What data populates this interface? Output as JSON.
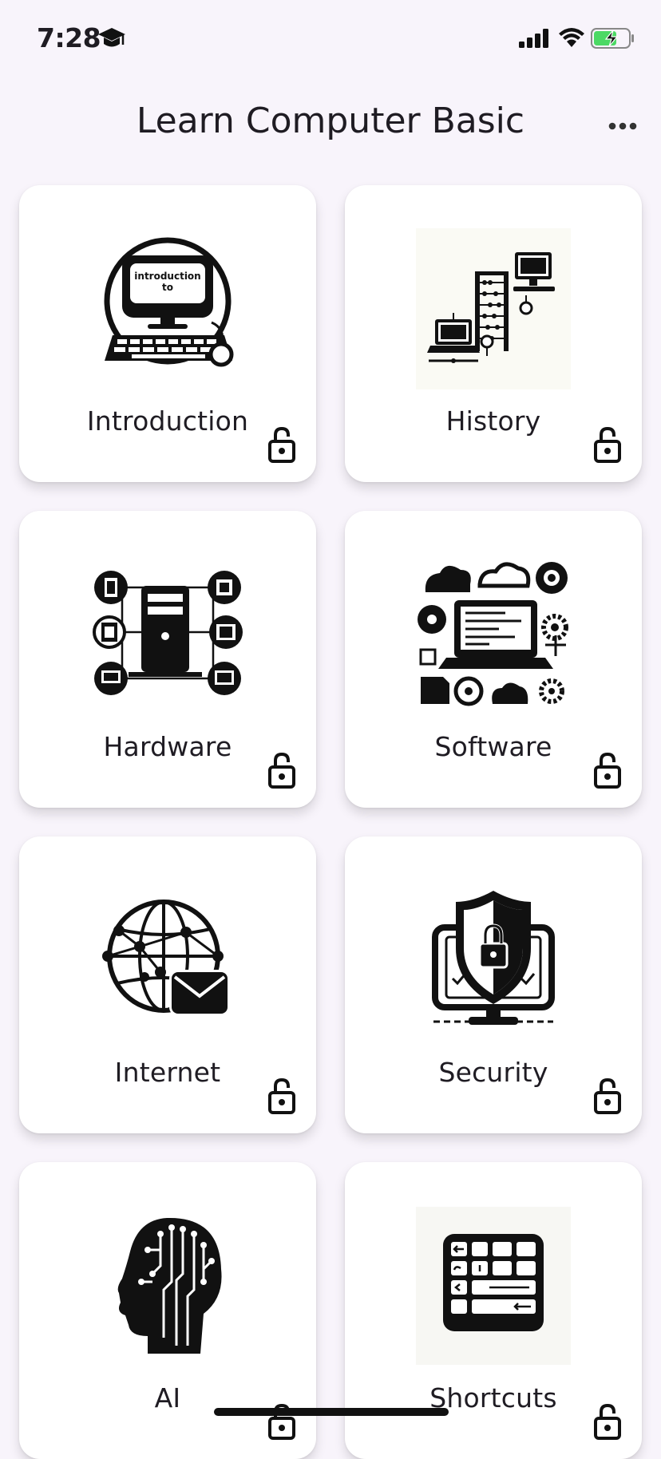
{
  "status": {
    "time": "7:28"
  },
  "app_bar": {
    "title": "Learn Computer Basic",
    "more_icon": "more-horizontal-icon"
  },
  "cards": [
    {
      "label": "Introduction",
      "icon": "introduction-computer-icon",
      "locked": true
    },
    {
      "label": "History",
      "icon": "history-abacus-computers-icon",
      "locked": true
    },
    {
      "label": "Hardware",
      "icon": "hardware-components-icon",
      "locked": true
    },
    {
      "label": "Software",
      "icon": "software-laptop-cloud-icon",
      "locked": true
    },
    {
      "label": "Internet",
      "icon": "internet-globe-mail-icon",
      "locked": true
    },
    {
      "label": "Security",
      "icon": "security-shield-lock-icon",
      "locked": true
    },
    {
      "label": "AI",
      "icon": "ai-head-circuit-icon",
      "locked": true
    },
    {
      "label": "Shortcuts",
      "icon": "shortcuts-keyboard-icon",
      "locked": true
    }
  ],
  "art": {
    "intro_screen_text_1": "introduction",
    "intro_screen_text_2": "to"
  }
}
